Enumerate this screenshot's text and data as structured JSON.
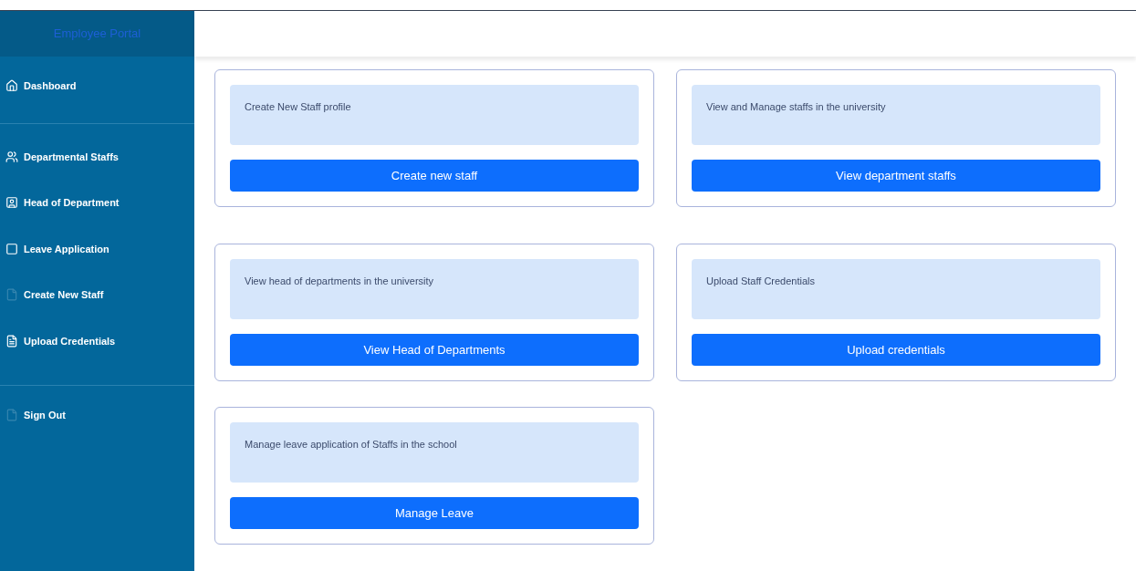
{
  "sidebar": {
    "title": "Employee Portal",
    "groups": [
      [
        {
          "label": "Dashboard",
          "kind": "home"
        }
      ],
      [
        {
          "label": "Departmental Staffs",
          "kind": "users"
        },
        {
          "label": "Head of Department",
          "kind": "badge"
        },
        {
          "label": "Leave Application",
          "kind": "square"
        },
        {
          "label": "Create New Staff",
          "kind": "dim"
        },
        {
          "label": "Upload Credentials",
          "kind": "file"
        }
      ],
      [
        {
          "label": "Sign Out",
          "kind": "dim"
        }
      ]
    ]
  },
  "cards": [
    {
      "description": "Create New Staff profile",
      "button": "Create new staff"
    },
    {
      "description": "View and Manage staffs in the university",
      "button": "View department staffs"
    },
    {
      "description": "View head of departments in the university",
      "button": "View Head of Departments"
    },
    {
      "description": "Upload Staff Credentials",
      "button": "Upload credentials"
    },
    {
      "description": "Manage leave application of Staffs in the school",
      "button": "Manage Leave"
    }
  ]
}
